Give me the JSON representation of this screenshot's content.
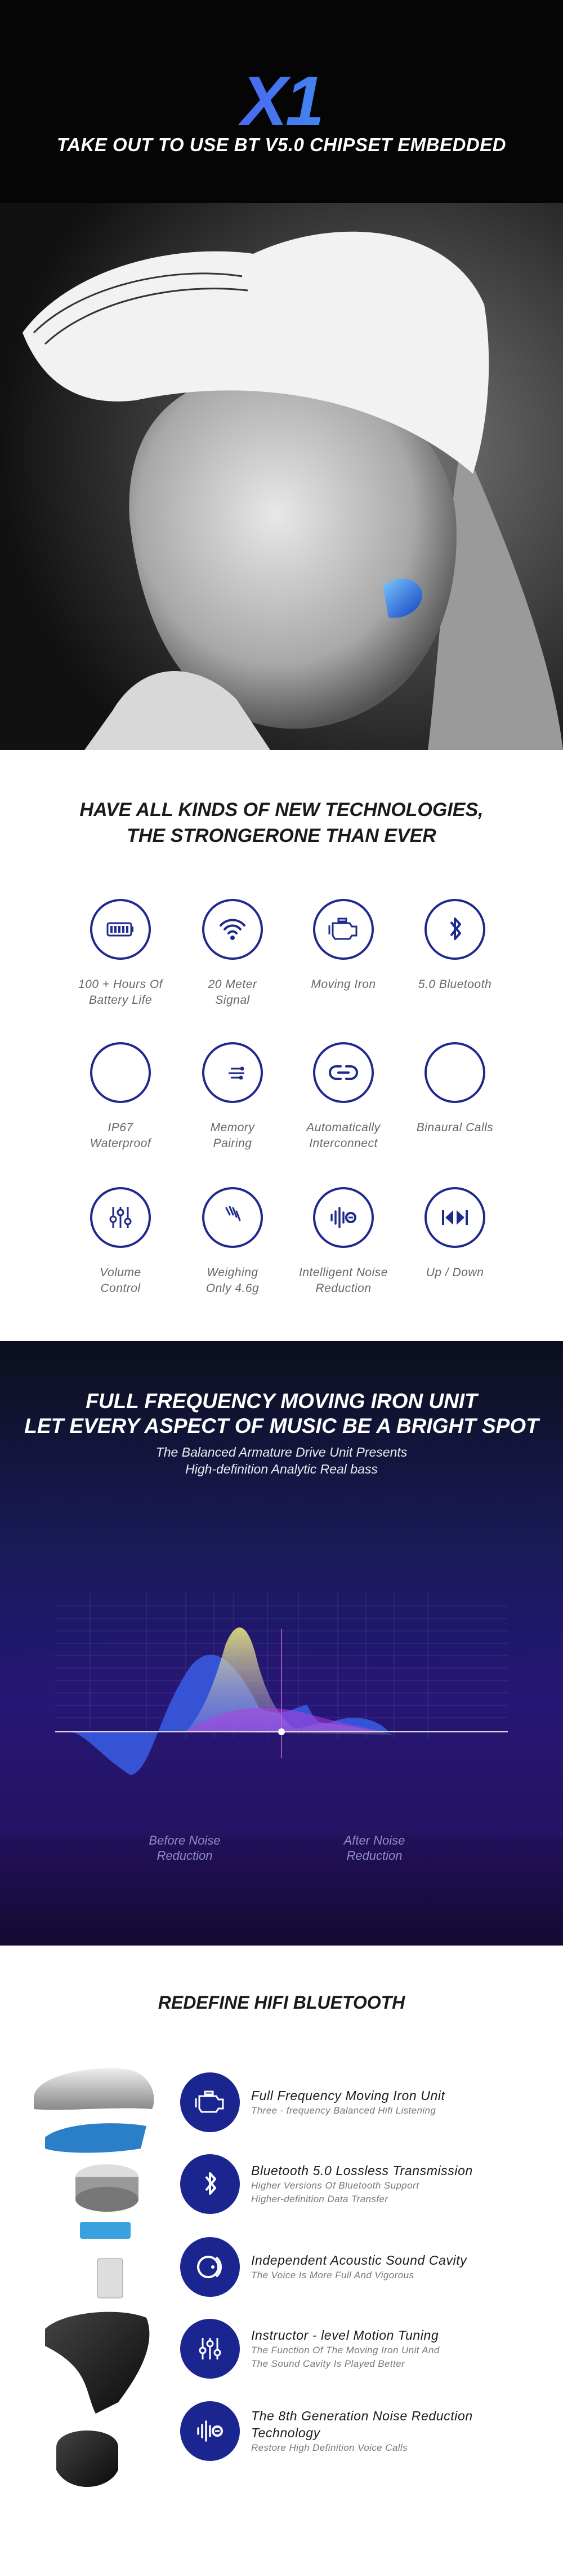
{
  "hero": {
    "title": "X1",
    "tagline": "TAKE OUT TO USE BT V5.0 CHIPSET EMBEDDED"
  },
  "features": {
    "heading": [
      "HAVE ALL KINDS OF NEW TECHNOLOGIES,",
      "THE STRONGERONE THAN EVER"
    ],
    "items": [
      {
        "icon": "battery-icon",
        "label": [
          "100 + Hours Of",
          "Battery Life"
        ]
      },
      {
        "icon": "wifi-signal-icon",
        "label": [
          "20 Meter",
          "Signal"
        ]
      },
      {
        "icon": "moving-iron-icon",
        "label": [
          "Moving Iron"
        ]
      },
      {
        "icon": "bluetooth-icon",
        "label": [
          "5.0 Bluetooth"
        ]
      },
      {
        "icon": "water-drop-icon",
        "label": [
          "IP67",
          "Waterproof"
        ]
      },
      {
        "icon": "cloud-circuit-icon",
        "label": [
          "Memory",
          "Pairing"
        ]
      },
      {
        "icon": "link-icon",
        "label": [
          "Automatically",
          "Interconnect"
        ]
      },
      {
        "icon": "ears-icon",
        "label": [
          "Binaural Calls"
        ]
      },
      {
        "icon": "sliders-icon",
        "label": [
          "Volume",
          "Control"
        ]
      },
      {
        "icon": "feather-icon",
        "label": [
          "Weighing",
          "Only 4.6g"
        ]
      },
      {
        "icon": "noise-reduction-icon",
        "label": [
          "Intelligent Noise",
          "Reduction"
        ]
      },
      {
        "icon": "prev-next-icon",
        "label": [
          "Up / Down"
        ]
      }
    ]
  },
  "sound": {
    "heading": [
      "FULL FREQUENCY MOVING IRON UNIT",
      "LET EVERY ASPECT OF MUSIC BE A BRIGHT SPOT"
    ],
    "subtitle": [
      "The Balanced Armature Drive Unit Presents",
      "High-definition Analytic Real bass"
    ],
    "before_label": [
      "Before Noise",
      "Reduction"
    ],
    "after_label": [
      "After  Noise",
      "Reduction"
    ],
    "colors": {
      "before": "#3a5ee8",
      "after": "#e8e878",
      "accent": "#c040c0"
    }
  },
  "hifi": {
    "heading": "REDEFINE HIFI BLUETOOTH",
    "rows": [
      {
        "icon": "moving-iron-icon",
        "title": [
          "Full Frequency Moving Iron Unit"
        ],
        "sub": [
          "Three - frequency Balanced Hifi Listening"
        ]
      },
      {
        "icon": "bluetooth-icon",
        "title": [
          "Bluetooth 5.0 Lossless Transmission"
        ],
        "sub": [
          "Higher Versions Of Bluetooth Support",
          "Higher-definition Data Transfer"
        ]
      },
      {
        "icon": "sound-cavity-icon",
        "title": [
          "Independent Acoustic Sound Cavity"
        ],
        "sub": [
          "The Voice Is More Full And Vigorous"
        ]
      },
      {
        "icon": "sliders-icon",
        "title": [
          "Instructor - level Motion Tuning"
        ],
        "sub": [
          "The Function Of The Moving Iron Unit And",
          "The Sound Cavity Is Played Better"
        ]
      },
      {
        "icon": "noise-reduction-icon",
        "title": [
          "The 8th Generation Noise Reduction",
          " Technology"
        ],
        "sub": [
          "Restore High Definition Voice Calls"
        ]
      }
    ]
  },
  "colors": {
    "brand_blue": "#1d2a8c",
    "hero_bg": "#050505"
  }
}
